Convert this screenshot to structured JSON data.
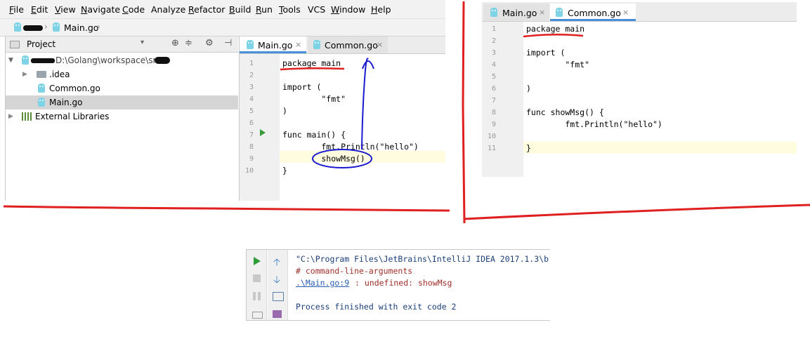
{
  "left_ide": {
    "menu": [
      {
        "mnemonic": "F",
        "rest": "ile"
      },
      {
        "mnemonic": "E",
        "rest": "dit"
      },
      {
        "mnemonic": "V",
        "rest": "iew"
      },
      {
        "mnemonic": "N",
        "rest": "avigate"
      },
      {
        "mnemonic": "C",
        "rest": "ode"
      },
      {
        "mnemonic": "",
        "rest": "Analyze"
      },
      {
        "mnemonic": "R",
        "rest": "efactor"
      },
      {
        "mnemonic": "B",
        "rest": "uild"
      },
      {
        "mnemonic": "R",
        "rest": "un"
      },
      {
        "mnemonic": "T",
        "rest": "ools"
      },
      {
        "mnemonic": "",
        "rest": "VCS"
      },
      {
        "mnemonic": "W",
        "rest": "indow"
      },
      {
        "mnemonic": "H",
        "rest": "elp"
      }
    ],
    "breadcrumb": {
      "file": "Main.go"
    },
    "project_panel": {
      "title": "Project",
      "root_path": "D:\\Golang\\workspace\\src\\",
      "items": [
        {
          "label": ".idea"
        },
        {
          "label": "Common.go"
        },
        {
          "label": "Main.go"
        },
        {
          "label": "External Libraries"
        }
      ]
    },
    "tabs": [
      {
        "label": "Main.go",
        "active": true
      },
      {
        "label": "Common.go",
        "active": false
      }
    ],
    "code_lines": [
      {
        "n": "1",
        "text": "package main"
      },
      {
        "n": "2",
        "text": ""
      },
      {
        "n": "3",
        "text": "import ("
      },
      {
        "n": "4",
        "text": "        \"fmt\""
      },
      {
        "n": "5",
        "text": ")"
      },
      {
        "n": "6",
        "text": ""
      },
      {
        "n": "7",
        "text": "func main() {"
      },
      {
        "n": "8",
        "text": "        fmt.Println(\"hello\")"
      },
      {
        "n": "9",
        "text": "        showMsg()"
      },
      {
        "n": "10",
        "text": "}"
      }
    ]
  },
  "right_ide": {
    "tabs": [
      {
        "label": "Main.go",
        "active": false
      },
      {
        "label": "Common.go",
        "active": true
      }
    ],
    "code_lines": [
      {
        "n": "1",
        "text": "package main"
      },
      {
        "n": "2",
        "text": ""
      },
      {
        "n": "3",
        "text": "import ("
      },
      {
        "n": "4",
        "text": "        \"fmt\""
      },
      {
        "n": "5",
        "text": ""
      },
      {
        "n": "6",
        "text": ")"
      },
      {
        "n": "7",
        "text": ""
      },
      {
        "n": "8",
        "text": "func showMsg() {"
      },
      {
        "n": "9",
        "text": "        fmt.Println(\"hello\")"
      },
      {
        "n": "10",
        "text": ""
      },
      {
        "n": "11",
        "text": "}"
      }
    ]
  },
  "run_panel": {
    "lines": [
      {
        "text": "\"C:\\Program Files\\JetBrains\\IntelliJ IDEA 2017.1.3\\b",
        "kind": "cmd"
      },
      {
        "text": "# command-line-arguments",
        "kind": "error"
      },
      {
        "link": ".\\Main.go:9",
        "rest": ": undefined: showMsg",
        "kind": "link"
      },
      {
        "text": "",
        "kind": "blank"
      },
      {
        "text": "Process finished with exit code 2",
        "kind": "info"
      }
    ]
  },
  "colors": {
    "annotation_red": "#e02020",
    "annotation_blue": "#1a1ad0",
    "keyword": "#000080",
    "string": "#008000",
    "error_text": "#a0302a",
    "link": "#2a5db0",
    "process_text": "#1b3f7a",
    "current_line": "#fffce0"
  },
  "icons": [
    "gopher-file-icon",
    "folder-icon",
    "run-icon",
    "stop-icon",
    "arrow-up-icon",
    "arrow-down-icon",
    "gear-icon",
    "library-icon"
  ]
}
